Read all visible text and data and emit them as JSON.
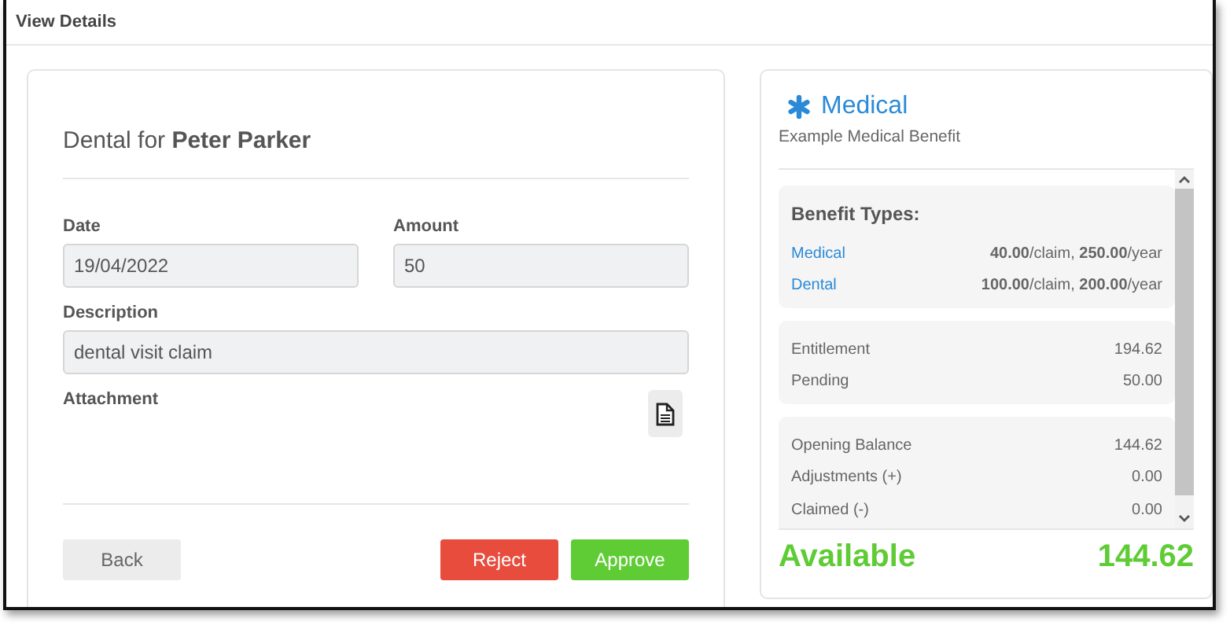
{
  "page": {
    "title": "View Details"
  },
  "claim": {
    "heading": "Dental for **Peter Parker**",
    "fields": [
      {
        "label": "Date",
        "value": "19/04/2022"
      },
      {
        "label": "Amount",
        "value": "50"
      },
      {
        "label": "Description",
        "value": "dental visit claim"
      }
    ],
    "attachment": {
      "label": "Attachment"
    },
    "buttons": [
      {
        "label": "Back",
        "kind": "default"
      },
      {
        "label": "Reject",
        "kind": "danger"
      },
      {
        "label": "Approve",
        "kind": "success"
      }
    ]
  },
  "benefit": {
    "title": "Medical",
    "subtitle": "Example Medical Benefit",
    "types_heading": "Benefit Types:",
    "types": [
      {
        "name": "Medical",
        "limits": "**40.00**/claim, **250.00**/year"
      },
      {
        "name": "Dental",
        "limits": "**100.00**/claim, **200.00**/year"
      }
    ],
    "groups": [
      [
        {
          "label": "Entitlement",
          "value": "194.62"
        },
        {
          "label": "Pending",
          "value": "50.00"
        }
      ],
      [
        {
          "label": "Opening Balance",
          "value": "144.62"
        },
        {
          "label": "Adjustments (+)",
          "value": "0.00"
        },
        {
          "label": "Claimed (-)",
          "value": "0.00"
        }
      ]
    ],
    "available": {
      "label": "Available",
      "value": "144.62"
    }
  }
}
